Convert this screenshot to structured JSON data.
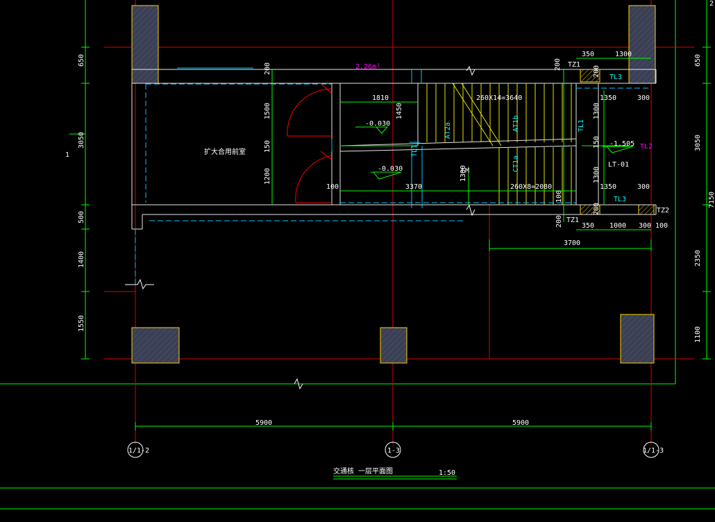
{
  "drawing": {
    "title": "交通核 一层平面图",
    "scale": "1:50",
    "room_label": "扩大合用前室",
    "area_note": "2.26m²"
  },
  "axes": {
    "left": "1/1-2",
    "middle": "1-3",
    "right": "1/1-3",
    "bay_left": "5900",
    "bay_right": "5900"
  },
  "elevations": {
    "stair_landing": "-0.030",
    "lobby": "-0.030",
    "mid_landing": "-1.505"
  },
  "stair": {
    "upper_run": "260X14=3640",
    "lower_run": "260X8=2080",
    "id": "LT-01",
    "flight_a": "AT2a",
    "flight_b": "AT1b",
    "flight_c": "CT1a"
  },
  "tags": {
    "tz1_top": "TZ1",
    "tz1_bottom": "TZ1",
    "tz2": "TZ2",
    "tl2": "TL2",
    "tl3_top": "TL3",
    "tl3_bottom": "TL3",
    "tl1": "TL1",
    "tl1_b": "TL1",
    "fm": "FM"
  },
  "dims": {
    "d1810": "1810",
    "d1350_top": "1350",
    "d300_top": "300",
    "d350_top": "350",
    "d1300_top": "1300",
    "d3370": "3370",
    "d100_left": "100",
    "d1350_bot": "1350",
    "d300_bot": "300",
    "d350_bot": "350",
    "d1000_bot": "1000",
    "d300_bot2": "300",
    "d100_bot": "100",
    "d3700": "3700",
    "d1450": "1450",
    "d1300_mid": "1300",
    "d1300_right": "1300",
    "d150_right": "150",
    "d200_top": "200",
    "d200_top2": "200",
    "d1500": "1500",
    "d150_mid": "150",
    "d1200": "1200",
    "d200_mid": "200",
    "d100_right_low": "100",
    "d200_right_low": "200",
    "d200_bot": "200",
    "d1300_stair": "1300",
    "left_650": "650",
    "left_3050": "3050",
    "left_1": "1",
    "left_500": "500",
    "left_1400": "1400",
    "left_1550": "1550",
    "right_650": "650",
    "right_3050": "3050",
    "right_2350": "2350",
    "right_1100": "1100",
    "right_7150": "7150",
    "top_2": "2"
  }
}
